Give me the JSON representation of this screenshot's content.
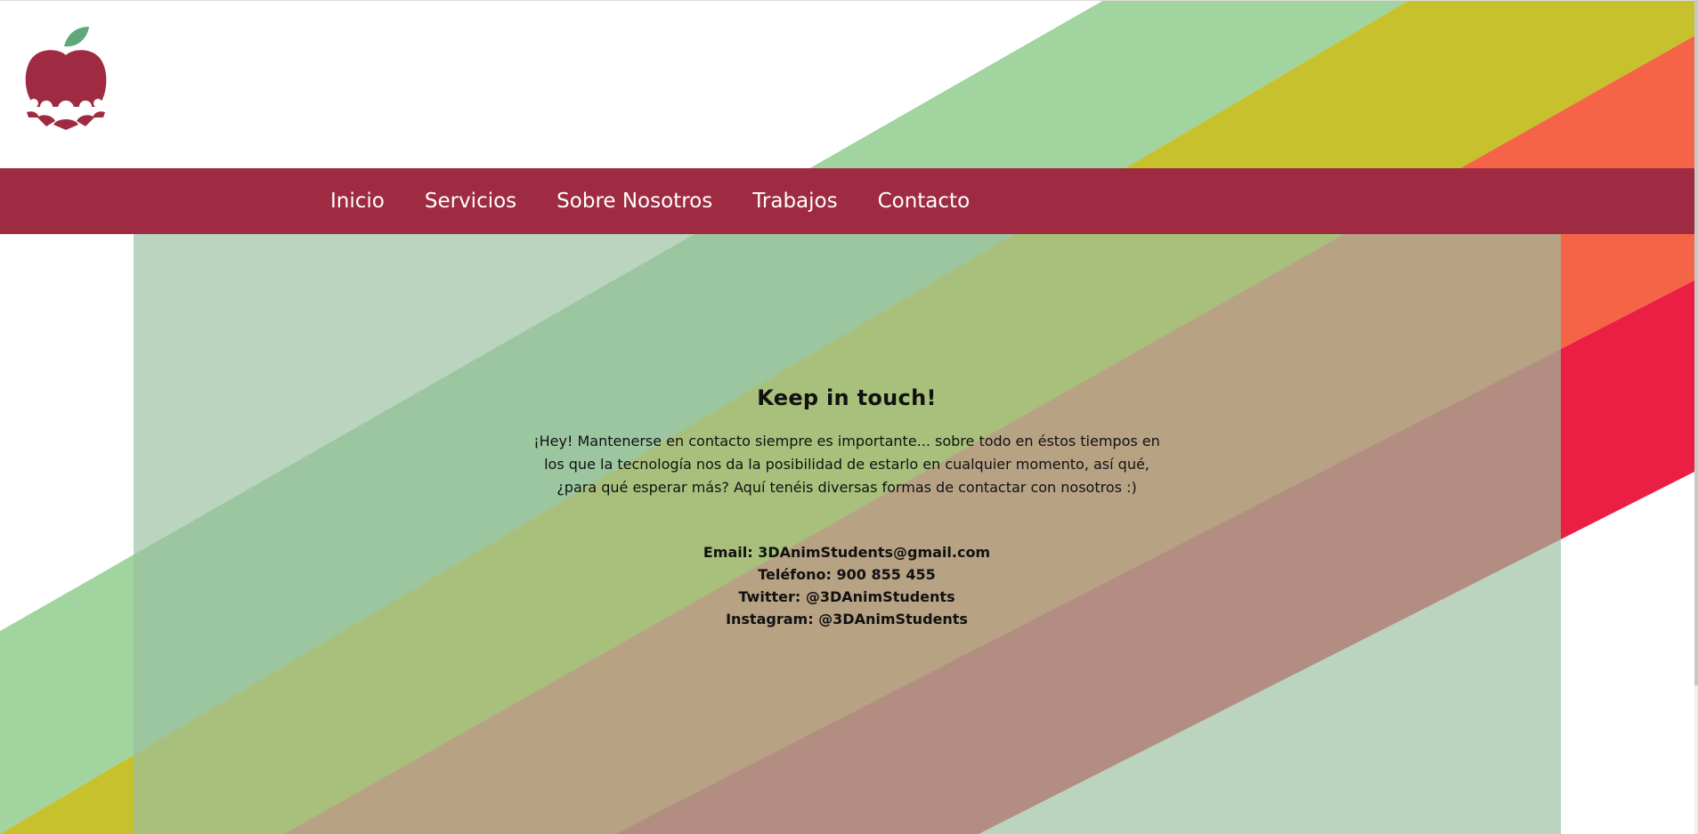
{
  "colors": {
    "brand": "#9e2b42",
    "stripe_green": "#a1d49f",
    "stripe_yellow": "#c7c12d",
    "stripe_orange": "#f56447",
    "stripe_red": "#ea1f43",
    "leaf": "#5fa879",
    "panel_overlay": "#99c0a0"
  },
  "logo": {
    "icon": "apple-people-logo-icon"
  },
  "nav": {
    "items": [
      {
        "label": "Inicio"
      },
      {
        "label": "Servicios"
      },
      {
        "label": "Sobre Nosotros"
      },
      {
        "label": "Trabajos"
      },
      {
        "label": "Contacto"
      }
    ]
  },
  "contact": {
    "title": "Keep in touch!",
    "intro": "¡Hey! Mantenerse en contacto siempre es importante... sobre todo en éstos tiempos en los que la tecnología nos da la posibilidad de estarlo en cualquier momento, así qué, ¿para qué esperar más? Aquí tenéis diversas formas de contactar con nosotros :)",
    "email": "Email: 3DAnimStudents@gmail.com",
    "phone": "Teléfono: 900 855 455",
    "twitter": "Twitter: @3DAnimStudents",
    "instagram": "Instagram: @3DAnimStudents"
  }
}
